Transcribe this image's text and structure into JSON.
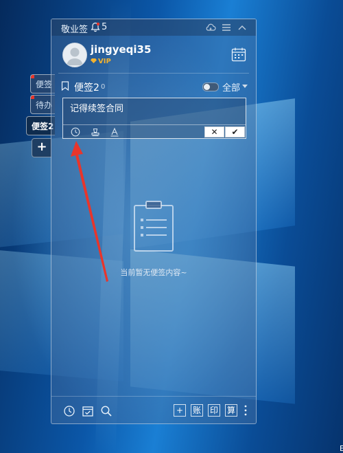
{
  "window": {
    "app_title": "敬业签",
    "notification_count": "5",
    "icons": [
      "bell-icon",
      "cloud-sync-icon",
      "menu-icon",
      "collapse-icon"
    ]
  },
  "user": {
    "username": "jingyeqi35",
    "badge": "VIP",
    "avatar_icon": "user-avatar-icon",
    "calendar_icon": "calendar-icon"
  },
  "side_tabs": [
    {
      "label": "便签",
      "has_mark": true
    },
    {
      "label": "待办",
      "has_mark": true
    },
    {
      "label": "便签2",
      "active": true
    }
  ],
  "side_add_label": "+",
  "category": {
    "name": "便签2",
    "count": "0",
    "filter_label": "全部"
  },
  "editor": {
    "value": "记得续签合同",
    "tools": [
      "clock-icon",
      "stamp-icon",
      "text-color-icon"
    ],
    "cancel_label": "✕",
    "confirm_label": "✔"
  },
  "empty_state": {
    "text": "当前暂无便签内容~",
    "icon": "clipboard-icon"
  },
  "bottom_bar": {
    "left_icons": [
      "history-clock-icon",
      "done-list-icon",
      "search-icon"
    ],
    "right_buttons": [
      "+",
      "账",
      "印",
      "算"
    ]
  },
  "corner_text": "E",
  "colors": {
    "annotation_arrow": "#e8352b",
    "vip_gold": "#f2b230",
    "panel_border": "#ffffff"
  }
}
